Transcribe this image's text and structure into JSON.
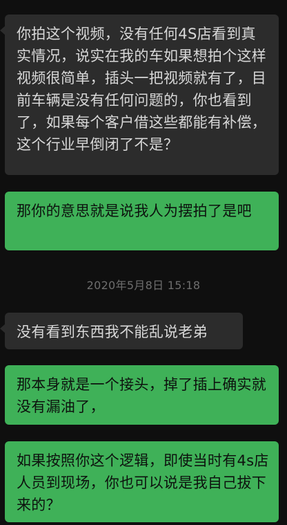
{
  "conversation": {
    "messages": [
      {
        "direction": "incoming",
        "text": "你拍这个视频，没有任何4S店看到真实情况，说实在我的车如果想拍个这样视频很简单，插头一把视频就有了，目前车辆是没有任何问题的，你也看到了，如果每个客户借这些都能有补偿，这个行业早倒闭了不是？"
      },
      {
        "direction": "outgoing",
        "text": "那你的意思就是说我人为摆拍了是吧"
      },
      {
        "direction": "timestamp",
        "text": "2020年5月8日 15:18"
      },
      {
        "direction": "incoming",
        "text": "没有看到东西我不能乱说老弟"
      },
      {
        "direction": "outgoing",
        "text": "那本身就是一个接头，掉了插上确实就没有漏油了，"
      },
      {
        "direction": "outgoing",
        "text": "如果按照你这个逻辑，即使当时有4s店人员到现场，你也可以说是我自己拔下来的？"
      }
    ]
  },
  "colors": {
    "background": "#0f0f0f",
    "incoming_bubble": "#2c2c2c",
    "outgoing_bubble": "#3fb158",
    "timestamp_text": "#6e6e6e"
  }
}
